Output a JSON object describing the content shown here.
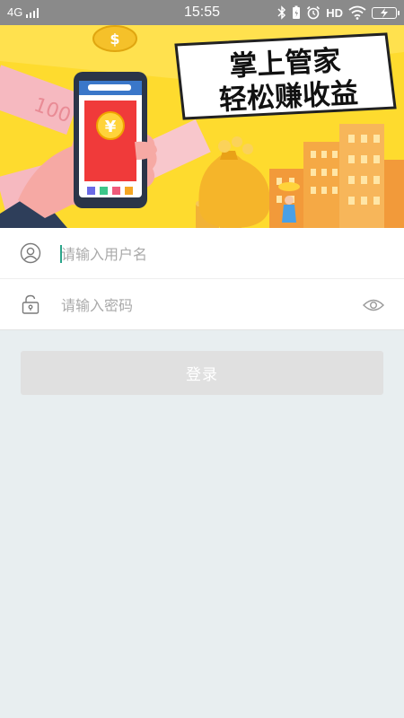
{
  "status_bar": {
    "network": "4G",
    "time": "15:55",
    "hd_label": "HD"
  },
  "banner": {
    "headline_line1": "掌上管家",
    "headline_line2": "轻松赚收益",
    "phone_coin_symbol": "¥",
    "top_coin_symbol": "$",
    "banknote_text": "100",
    "colors": {
      "background": "#fedb2e",
      "headline": "#111111"
    }
  },
  "login_form": {
    "username": {
      "placeholder": "请输入用户名",
      "value": ""
    },
    "password": {
      "placeholder": "请输入密码",
      "value": ""
    },
    "login_label": "登录"
  },
  "icons": {
    "username": "user-icon",
    "password": "lock-icon",
    "toggle": "eye-icon"
  },
  "colors": {
    "page_background": "#e8eef0",
    "cursor": "#2aa58a",
    "button_disabled": "#e0e0e0"
  }
}
